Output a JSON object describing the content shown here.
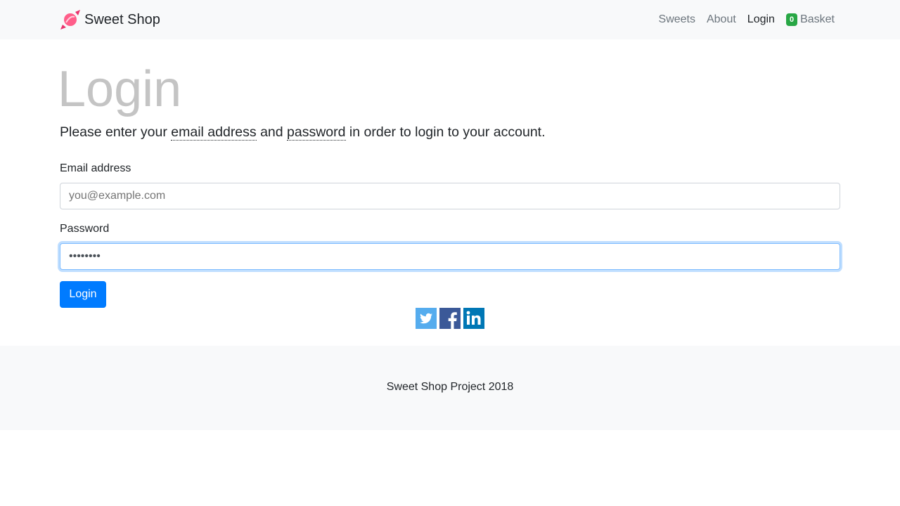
{
  "navbar": {
    "brand": "Sweet Shop",
    "brand_icon": "candy-icon",
    "links": [
      {
        "label": "Sweets"
      },
      {
        "label": "About"
      },
      {
        "label": "Login",
        "active": true
      }
    ],
    "basket": {
      "count": "0",
      "label": "Basket"
    }
  },
  "login": {
    "title": "Login",
    "lead_before": "Please enter your ",
    "lead_email": "email address",
    "lead_and": " and ",
    "lead_password": "password",
    "lead_after": " in order to login to your account.",
    "email_label": "Email address",
    "email_placeholder": "you@example.com",
    "password_label": "Password",
    "password_value": "••••••••",
    "submit_label": "Login"
  },
  "social": [
    "twitter-icon",
    "facebook-icon",
    "linkedin-icon"
  ],
  "colors": {
    "primary": "#007bff",
    "badge": "#28a745",
    "twitter": "#55acee",
    "facebook": "#3b5998",
    "linkedin": "#0077b5"
  },
  "footer": {
    "text": "Sweet Shop Project 2018"
  }
}
